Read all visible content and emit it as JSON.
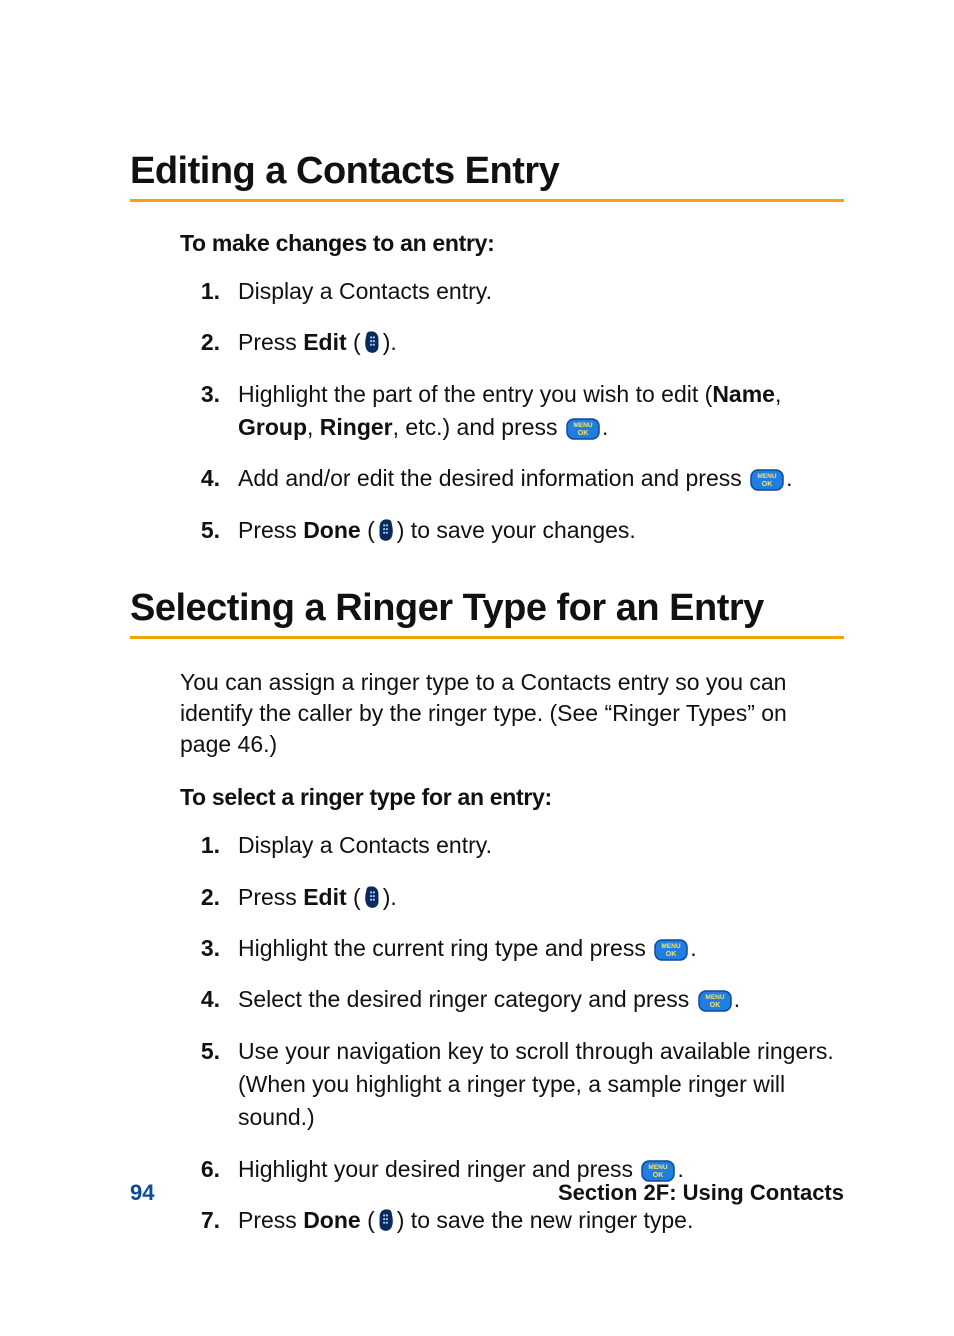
{
  "section1": {
    "title": "Editing a Contacts Entry",
    "intro": "To make changes to an entry:",
    "steps": [
      {
        "num": "1.",
        "plain": "Display a Contacts entry."
      },
      {
        "num": "2.",
        "pre": "Press ",
        "bold": "Edit",
        "post1": " (",
        "post2": ")."
      },
      {
        "num": "3.",
        "pre": "Highlight the part of the entry you wish to edit (",
        "bold1": "Name",
        "mid": ", ",
        "bold2": "Group",
        "mid2": ", ",
        "bold3": "Ringer",
        "post1": ", etc.) and press ",
        "post2": "."
      },
      {
        "num": "4.",
        "pre": "Add and/or edit the desired information and press ",
        "post": "."
      },
      {
        "num": "5.",
        "pre": "Press ",
        "bold": "Done",
        "post1": " (",
        "post2": ") to save your changes."
      }
    ]
  },
  "section2": {
    "title": "Selecting a Ringer Type for an Entry",
    "para": "You  can assign a ringer type to a Contacts entry so you can identify the caller by the ringer type. (See “Ringer Types” on page 46.)",
    "intro": "To select a ringer type for an entry:",
    "steps": [
      {
        "num": "1.",
        "plain": "Display a Contacts entry."
      },
      {
        "num": "2.",
        "pre": "Press ",
        "bold": "Edit",
        "post1": " (",
        "post2": ")."
      },
      {
        "num": "3.",
        "pre": "Highlight the current ring type and press ",
        "post": "."
      },
      {
        "num": "4.",
        "pre": "Select the desired ringer category and press ",
        "post": "."
      },
      {
        "num": "5.",
        "plain": "Use your navigation key to scroll through available ringers. (When you highlight a ringer type, a sample ringer will sound.)"
      },
      {
        "num": "6.",
        "pre": "Highlight your desired ringer and press ",
        "post": "."
      },
      {
        "num": "7.",
        "pre": "Press ",
        "bold": "Done",
        "post1": " (",
        "post2": ") to save the new ringer type."
      }
    ]
  },
  "footer": {
    "page": "94",
    "label": "Section 2F: Using Contacts"
  }
}
